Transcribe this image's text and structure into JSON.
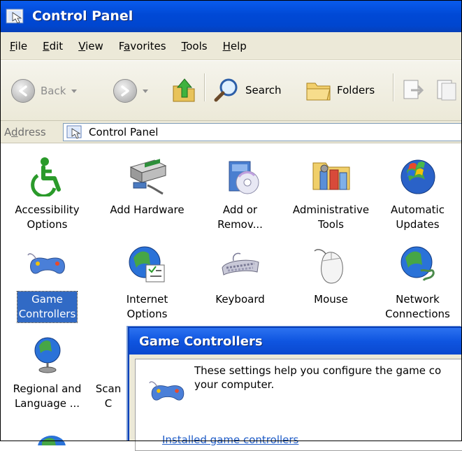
{
  "window": {
    "title": "Control Panel"
  },
  "menu": [
    "File",
    "Edit",
    "View",
    "Favorites",
    "Tools",
    "Help"
  ],
  "menu_accel": [
    "F",
    "E",
    "V",
    "a",
    "T",
    "H"
  ],
  "toolbar": {
    "back_label": "Back",
    "search_label": "Search",
    "folders_label": "Folders"
  },
  "address": {
    "label": "Address",
    "value": "Control Panel"
  },
  "items": [
    {
      "label": "Accessibility\nOptions",
      "icon": "accessibility-icon"
    },
    {
      "label": "Add Hardware",
      "icon": "add-hardware-icon"
    },
    {
      "label": "Add or\nRemov...",
      "icon": "add-remove-programs-icon"
    },
    {
      "label": "Administrative\nTools",
      "icon": "administrative-tools-icon"
    },
    {
      "label": "Automatic\nUpdates",
      "icon": "automatic-updates-icon"
    },
    {
      "label": "Game\nControllers",
      "icon": "game-controller-icon",
      "selected": true
    },
    {
      "label": "Internet\nOptions",
      "icon": "internet-options-icon"
    },
    {
      "label": "Keyboard",
      "icon": "keyboard-icon"
    },
    {
      "label": "Mouse",
      "icon": "mouse-icon"
    },
    {
      "label": "Network\nConnections",
      "icon": "network-connections-icon"
    },
    {
      "label": "Regional and\nLanguage ...",
      "icon": "regional-language-icon"
    },
    {
      "label": "Scan\nC",
      "icon": "scanners-cameras-icon"
    }
  ],
  "dialog": {
    "title": "Game Controllers",
    "description": "These settings help you configure the game controllers installed on your computer.",
    "description_visible": "These settings help you configure the game co\nyour computer.",
    "link": "Installed game controllers"
  },
  "colors": {
    "titlebar": "#0049d6",
    "selection": "#316ac5",
    "chrome": "#ece9d8"
  }
}
